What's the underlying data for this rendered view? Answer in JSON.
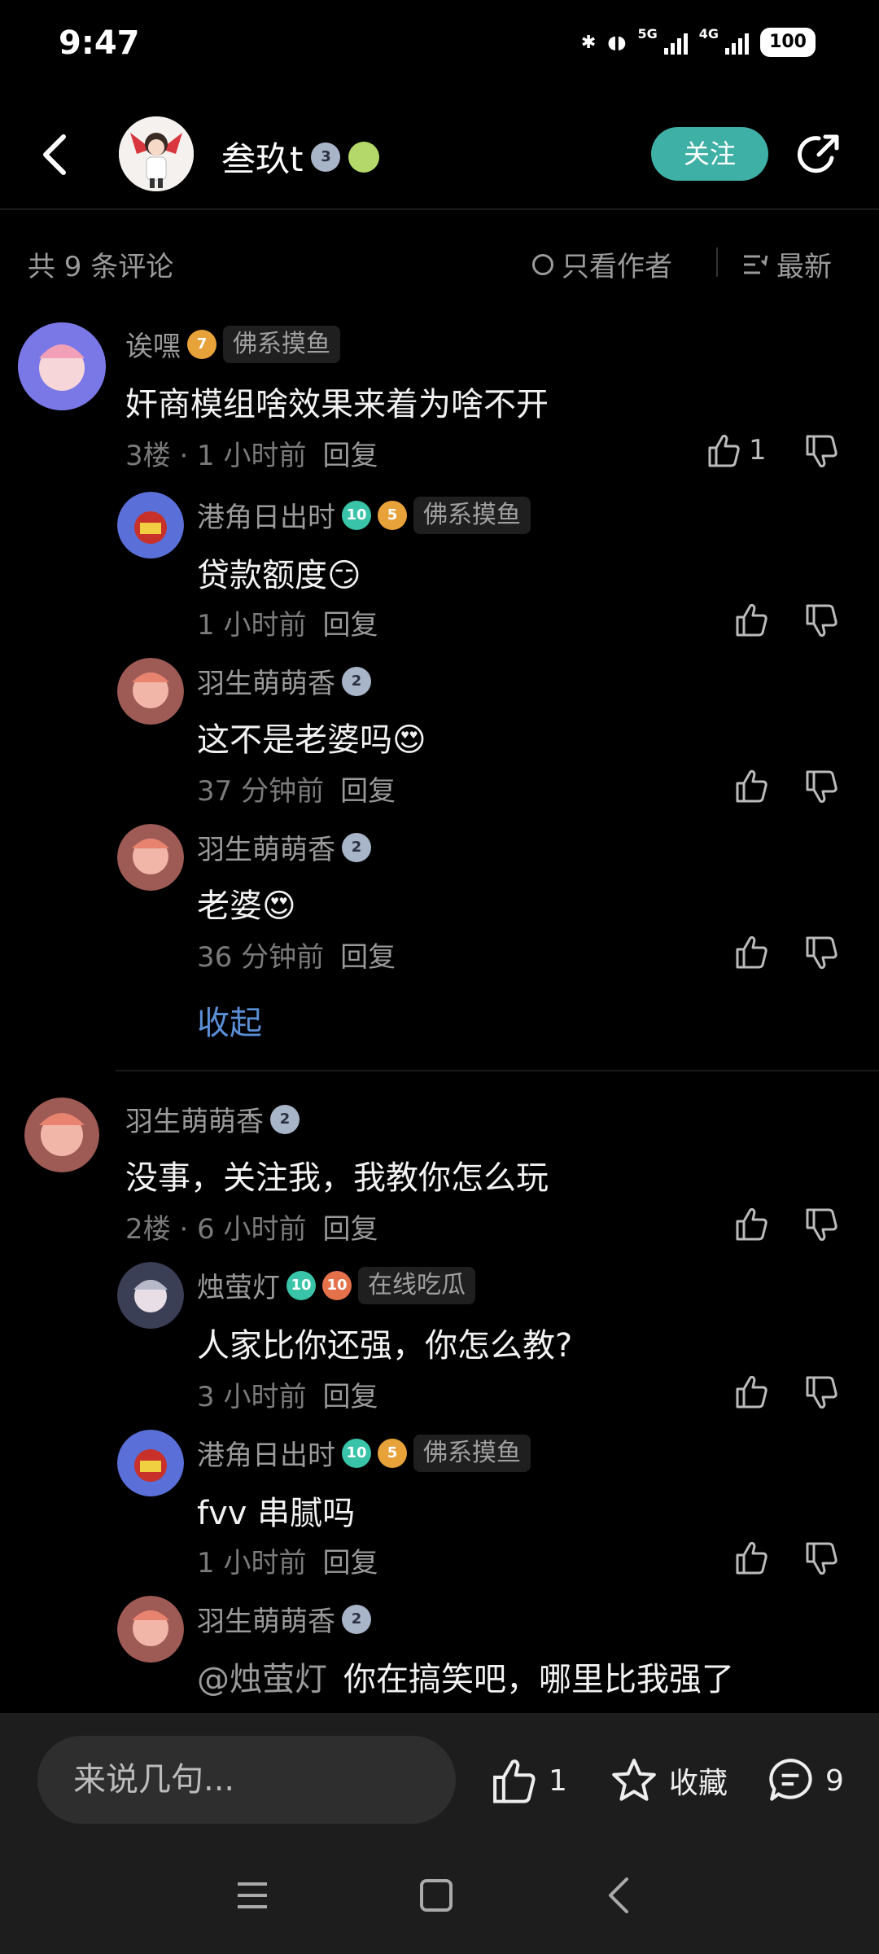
{
  "status": {
    "time": "9:47",
    "net1": "5G",
    "net2": "4G",
    "battery": "100"
  },
  "header": {
    "author": "叁玖t",
    "author_level": "3",
    "follow_label": "关注"
  },
  "filter": {
    "count_label": "共 9 条评论",
    "only_author_label": "只看作者",
    "sort_label": "最新"
  },
  "comments": [
    {
      "user": "诶嘿",
      "level": "7",
      "tag": "佛系摸鱼",
      "text": "奸商模组啥效果来着为啥不开",
      "meta": "3楼 · 1 小时前",
      "reply_label": "回复",
      "likes": "1",
      "replies": [
        {
          "user": "港角日出时",
          "level": "5",
          "tag": "佛系摸鱼",
          "text": "贷款额度😏",
          "meta": "1 小时前",
          "reply_label": "回复"
        },
        {
          "user": "羽生萌萌香",
          "level": "2",
          "text": "这不是老婆吗😍",
          "meta": "37 分钟前",
          "reply_label": "回复"
        },
        {
          "user": "羽生萌萌香",
          "level": "2",
          "text": "老婆😍",
          "meta": "36 分钟前",
          "reply_label": "回复"
        }
      ],
      "collapse_label": "收起"
    },
    {
      "user": "羽生萌萌香",
      "level": "2",
      "text": "没事，关注我，我教你怎么玩",
      "meta": "2楼 · 6 小时前",
      "reply_label": "回复",
      "replies": [
        {
          "user": "烛萤灯",
          "level": "10",
          "tag": "在线吃瓜",
          "text": "人家比你还强，你怎么教?",
          "meta": "3 小时前",
          "reply_label": "回复"
        },
        {
          "user": "港角日出时",
          "level": "5",
          "tag": "佛系摸鱼",
          "text": "fvv 串腻吗",
          "meta": "1 小时前",
          "reply_label": "回复"
        },
        {
          "user": "羽生萌萌香",
          "level": "2",
          "mention": "@烛萤灯",
          "text": "你在搞笑吧，哪里比我强了"
        }
      ]
    }
  ],
  "bottom": {
    "input_placeholder": "来说几句...",
    "like_count": "1",
    "fav_label": "收藏",
    "comment_count": "9"
  },
  "icons": [
    "back-icon",
    "share-icon",
    "sort-icon",
    "thumb-up-icon",
    "thumb-down-icon",
    "star-icon",
    "comment-icon",
    "menu-icon",
    "home-icon",
    "nav-back-icon"
  ],
  "colors": {
    "accent": "#3fb0a6",
    "link": "#5b8fd6",
    "background": "#000000"
  }
}
